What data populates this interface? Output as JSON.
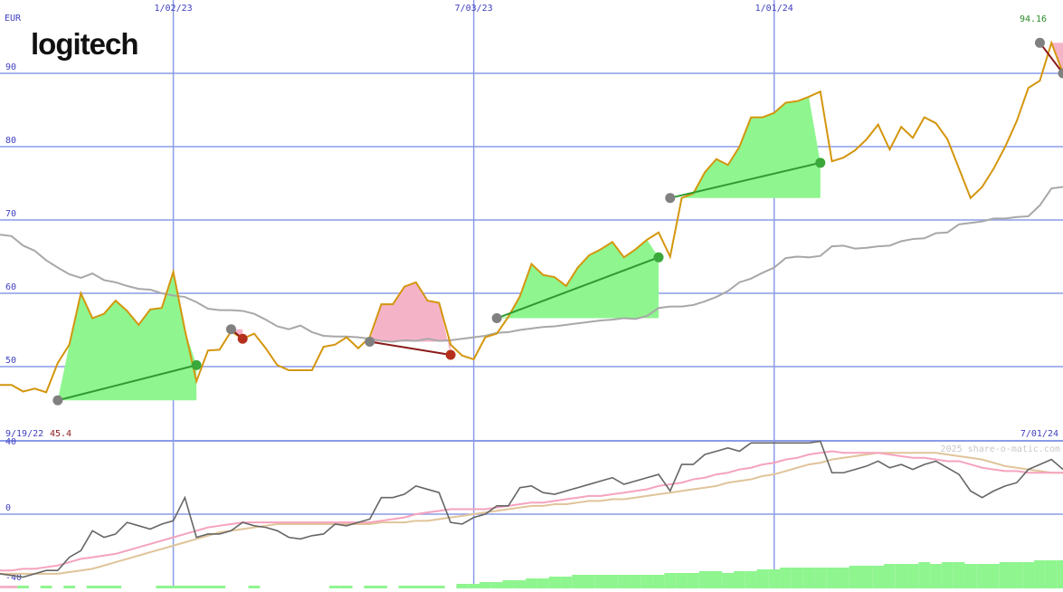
{
  "logo": {
    "text": "logitech"
  },
  "colors": {
    "grid": "#8c9be8",
    "price": "#d4960e",
    "ma": "#a8a8a8",
    "gain_fill": "#8ff58f",
    "gain_line": "#2f9a2f",
    "loss_fill": "#f5b3c8",
    "loss_line": "#8b1a1a",
    "gray_marker": "#808080",
    "osc_dark": "#666666",
    "osc_pink": "#f5a3be",
    "osc_tan": "#e0c49a",
    "volume": "#8ff58f",
    "axis_text": "#4040c0",
    "last_text": "#2a8a2a",
    "low_text": "#8b1a1a",
    "copyright": "#c8c8c8"
  },
  "chart_data": [
    {
      "type": "line",
      "currency": "EUR",
      "y_ticks": [
        "90",
        "80",
        "70",
        "60",
        "50"
      ],
      "ylim": [
        43,
        99
      ],
      "x_tick_labels": [
        "1/02/23",
        "7/03/23",
        "1/01/24"
      ],
      "x_ticks": [
        15,
        41,
        67
      ],
      "start_date": "9/19/22",
      "end_date": "7/01/24",
      "low_label": "45.4",
      "last_label": "94.16",
      "xlim": [
        0,
        92
      ],
      "price": [
        47.5,
        47.5,
        46.6,
        47.0,
        46.5,
        50.5,
        53.0,
        60.0,
        56.6,
        57.2,
        59.0,
        57.6,
        55.7,
        57.8,
        58.0,
        62.9,
        55.0,
        48.0,
        52.2,
        52.3,
        54.8,
        53.8,
        54.5,
        52.5,
        50.2,
        49.5,
        49.5,
        49.5,
        52.7,
        53.0,
        54.0,
        52.5,
        54.0,
        58.5,
        58.5,
        60.9,
        61.5,
        59.0,
        58.7,
        53.0,
        51.5,
        51.0,
        54.0,
        54.5,
        56.8,
        59.6,
        64.0,
        62.5,
        62.2,
        61.0,
        63.5,
        65.2,
        66.0,
        67.0,
        64.9,
        66.0,
        67.3,
        68.3,
        65.0,
        73.0,
        73.6,
        76.5,
        78.3,
        77.5,
        80.0,
        84.0,
        84.0,
        84.6,
        86.0,
        86.2,
        86.8,
        87.5,
        78.0,
        78.5,
        79.5,
        81.0,
        83.0,
        79.6,
        82.7,
        81.2,
        84.0,
        83.2,
        81.0,
        77.0,
        73.0,
        74.5,
        77.0,
        80.0,
        83.5,
        88.0,
        89.0,
        94.16,
        90.0
      ],
      "ma": [
        68.0,
        67.8,
        66.5,
        65.8,
        64.5,
        63.5,
        62.6,
        62.1,
        62.7,
        61.8,
        61.5,
        61.0,
        60.6,
        60.5,
        60.0,
        59.7,
        59.5,
        58.8,
        57.9,
        57.7,
        57.7,
        57.6,
        57.2,
        56.4,
        55.5,
        55.1,
        55.6,
        54.7,
        54.2,
        54.1,
        54.1,
        54.0,
        53.8,
        53.5,
        53.4,
        53.6,
        53.5,
        53.8,
        53.5,
        53.6,
        53.8,
        54.0,
        54.2,
        54.6,
        54.7,
        55.0,
        55.2,
        55.4,
        55.5,
        55.7,
        55.9,
        56.1,
        56.3,
        56.4,
        56.6,
        56.5,
        56.9,
        58.0,
        58.2,
        58.2,
        58.4,
        58.9,
        59.5,
        60.3,
        61.5,
        62.0,
        62.8,
        63.5,
        64.8,
        65.0,
        64.9,
        65.1,
        66.4,
        66.5,
        66.1,
        66.2,
        66.4,
        66.5,
        67.1,
        67.4,
        67.5,
        68.2,
        68.3,
        69.4,
        69.6,
        69.8,
        70.2,
        70.2,
        70.4,
        70.5,
        72.0,
        74.3,
        74.5
      ],
      "trades": [
        {
          "result": "gain",
          "entry_x": 5,
          "entry_y": 45.4,
          "exit_x": 17,
          "exit_y": 50.2
        },
        {
          "result": "loss",
          "entry_x": 20,
          "entry_y": 55.1,
          "exit_x": 21,
          "exit_y": 53.8
        },
        {
          "result": "loss",
          "entry_x": 32,
          "entry_y": 53.4,
          "exit_x": 39,
          "exit_y": 51.6
        },
        {
          "result": "gain",
          "entry_x": 43,
          "entry_y": 56.6,
          "exit_x": 57,
          "exit_y": 64.9
        },
        {
          "result": "gain",
          "entry_x": 58,
          "entry_y": 73.0,
          "exit_x": 71,
          "exit_y": 77.8
        },
        {
          "result": "loss",
          "entry_x": 90,
          "entry_y": 94.16,
          "exit_x": 92,
          "exit_y": 90.0
        }
      ]
    },
    {
      "type": "line",
      "y_ticks": [
        "40",
        "0",
        "-40"
      ],
      "ylim": [
        -45,
        45
      ],
      "copyright": "2025 share-o-matic.com",
      "series": [
        {
          "key": "fast",
          "values": [
            -36,
            -37,
            -38,
            -36,
            -34,
            -34,
            -26,
            -22,
            -10,
            -14,
            -12,
            -5,
            -7,
            -9,
            -6,
            -4,
            10,
            -14,
            -12,
            -12,
            -10,
            -5,
            -7,
            -8,
            -10,
            -14,
            -15,
            -13,
            -12,
            -6,
            -7,
            -5,
            -3,
            10,
            10,
            12,
            17,
            15,
            13,
            -5,
            -6,
            -2,
            0,
            5,
            5,
            16,
            17,
            13,
            12,
            14,
            16,
            18,
            20,
            22,
            18,
            20,
            22,
            24,
            14,
            30,
            30,
            36,
            38,
            40,
            38,
            43,
            43,
            43,
            43,
            43,
            43,
            44,
            25,
            25,
            27,
            29,
            32,
            28,
            30,
            27,
            30,
            32,
            28,
            24,
            14,
            10,
            14,
            17,
            19,
            27,
            30,
            33,
            27,
            25
          ]
        },
        {
          "key": "pink",
          "values": [
            -34,
            -34,
            -33,
            -33,
            -32,
            -31,
            -29,
            -27,
            -26,
            -25,
            -24,
            -22,
            -20,
            -18,
            -16,
            -14,
            -12,
            -10,
            -8,
            -7,
            -6,
            -5,
            -5,
            -5,
            -5,
            -5,
            -5,
            -5,
            -5,
            -5,
            -5,
            -5,
            -5,
            -4,
            -3,
            -2,
            0,
            1,
            2,
            3,
            3,
            3,
            3,
            4,
            5,
            6,
            7,
            7,
            8,
            9,
            10,
            11,
            11,
            12,
            13,
            14,
            15,
            17,
            18,
            19,
            21,
            22,
            24,
            25,
            27,
            28,
            30,
            31,
            33,
            34,
            36,
            37,
            38,
            37,
            37,
            37,
            37,
            36,
            35,
            34,
            34,
            33,
            32,
            32,
            30,
            28,
            27,
            26,
            26,
            25,
            25,
            25,
            25,
            25
          ]
        },
        {
          "key": "tan",
          "values": [
            -36,
            -36,
            -36,
            -36,
            -36,
            -36,
            -35,
            -34,
            -33,
            -31,
            -29,
            -27,
            -25,
            -23,
            -21,
            -19,
            -17,
            -15,
            -13,
            -11,
            -10,
            -9,
            -8,
            -7,
            -6,
            -6,
            -6,
            -6,
            -6,
            -6,
            -6,
            -6,
            -6,
            -5,
            -5,
            -5,
            -4,
            -4,
            -3,
            -2,
            -1,
            0,
            1,
            2,
            3,
            4,
            5,
            5,
            6,
            6,
            7,
            8,
            8,
            9,
            9,
            10,
            11,
            12,
            13,
            14,
            15,
            16,
            17,
            19,
            20,
            21,
            23,
            24,
            26,
            28,
            30,
            31,
            33,
            34,
            35,
            36,
            37,
            37,
            37,
            37,
            37,
            37,
            36,
            35,
            34,
            33,
            31,
            29,
            28,
            27,
            26,
            25,
            25,
            25
          ]
        }
      ],
      "volume": [
        -1,
        -1,
        1,
        0,
        1,
        0,
        1,
        0,
        1,
        1,
        1,
        0,
        0,
        0,
        1,
        1,
        1,
        1,
        1,
        1,
        0,
        0,
        1,
        0,
        0,
        0,
        0,
        0,
        0,
        1,
        1,
        0,
        1,
        1,
        0,
        1,
        1,
        1,
        1,
        0,
        2,
        2,
        3,
        3,
        4,
        4,
        5,
        5,
        6,
        6,
        7,
        7,
        7,
        7,
        7,
        7,
        7,
        7,
        8,
        8,
        8,
        9,
        9,
        8,
        9,
        9,
        10,
        10,
        11,
        11,
        11,
        11,
        11,
        11,
        12,
        12,
        12,
        13,
        13,
        13,
        14,
        13,
        14,
        14,
        13,
        13,
        13,
        14,
        14,
        14,
        15,
        15,
        15,
        15
      ]
    }
  ]
}
